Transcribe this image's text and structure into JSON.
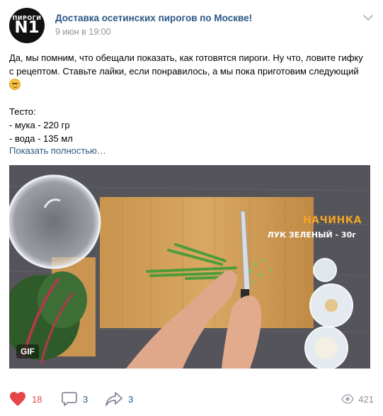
{
  "post": {
    "group_name": "Доставка осетинских пирогов по Москве!",
    "date": "9 июн в 19:00",
    "avatar": {
      "line1": "ПИРОГИ",
      "number": "N1"
    },
    "text_lines": [
      "Да, мы помним, что обещали показать, как готовятся пироги. Ну что, ловите гифку",
      "с рецептом. Ставьте лайки, если понравилось, а мы пока приготовим следующий",
      "",
      "Тесто:",
      "- мука - 220 гр",
      "- вода - 135 мл"
    ],
    "show_more": "Показать полностью…"
  },
  "media": {
    "badge": "GIF",
    "overlay_title": "НАЧИНКА",
    "overlay_subtitle": "ЛУК ЗЕЛЕНЫЙ - 30г"
  },
  "footer": {
    "likes": "18",
    "comments": "3",
    "shares": "3",
    "views": "421"
  },
  "colors": {
    "link": "#2a5885",
    "like_red": "#e64646",
    "muted": "#939393",
    "icon_gray": "#828a99"
  }
}
